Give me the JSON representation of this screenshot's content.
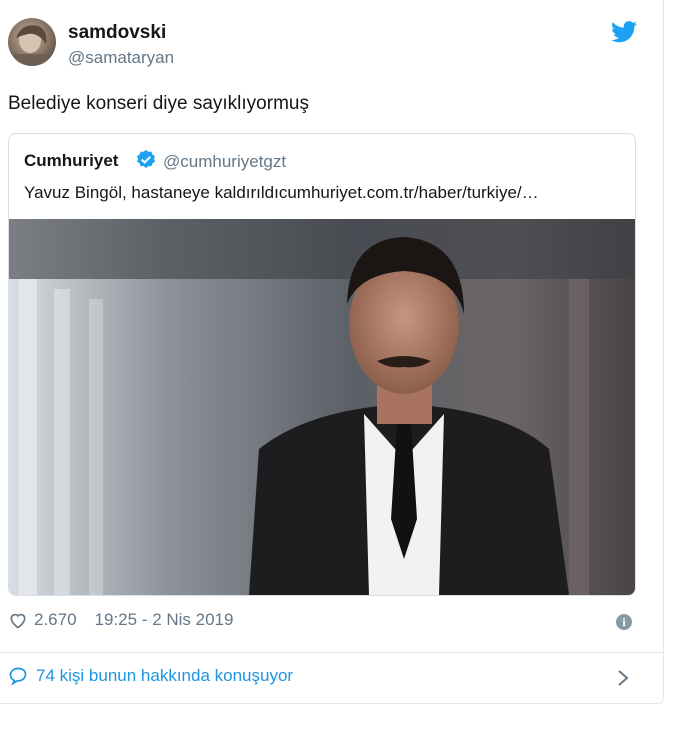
{
  "tweet": {
    "display_name": "samdovski",
    "handle": "@samataryan",
    "text": "Belediye konseri diye sayıklıyormuş",
    "avatar_icon": "user-avatar",
    "brand_icon": "twitter-bird-icon",
    "brand_color": "#1da1f2"
  },
  "quote": {
    "display_name": "Cumhuriyet",
    "verified": true,
    "handle": "@cumhuriyetgzt",
    "text": "Yavuz Bingöl, hastaneye kaldırıldıcumhuriyet.com.tr/haber/turkiye/…",
    "image_icon": "portrait-photo"
  },
  "stats": {
    "likes": "2.670",
    "timestamp": "19:25 - 2 Nis 2019"
  },
  "footer": {
    "talk_label": "74 kişi bunun hakkında konuşuyor",
    "link_color": "#1b95e0"
  }
}
